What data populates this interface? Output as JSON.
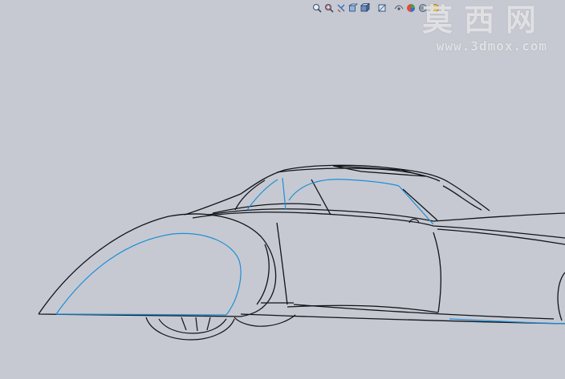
{
  "viewport": {
    "background": "#c6c9d2",
    "edge_color": "#111318",
    "highlight_color": "#1e8fd6"
  },
  "heads_up_toolbar": {
    "items": [
      {
        "id": "zoom-to-fit",
        "icon": "zoom-fit-icon"
      },
      {
        "id": "zoom-to-area",
        "icon": "zoom-area-icon"
      },
      {
        "id": "previous-view",
        "icon": "previous-view-icon"
      },
      {
        "id": "section-view",
        "icon": "section-view-icon"
      },
      {
        "id": "view-orientation",
        "icon": "view-orientation-icon"
      },
      {
        "id": "display-style",
        "icon": "display-style-icon"
      },
      {
        "id": "hide-show-items",
        "icon": "hide-show-icon"
      },
      {
        "id": "edit-appearance",
        "icon": "appearance-icon"
      },
      {
        "id": "apply-scene",
        "icon": "scene-icon"
      },
      {
        "id": "view-settings",
        "icon": "view-settings-icon"
      }
    ]
  },
  "watermark": {
    "chinese": "莫西网",
    "url": "www.3dmox.com"
  }
}
